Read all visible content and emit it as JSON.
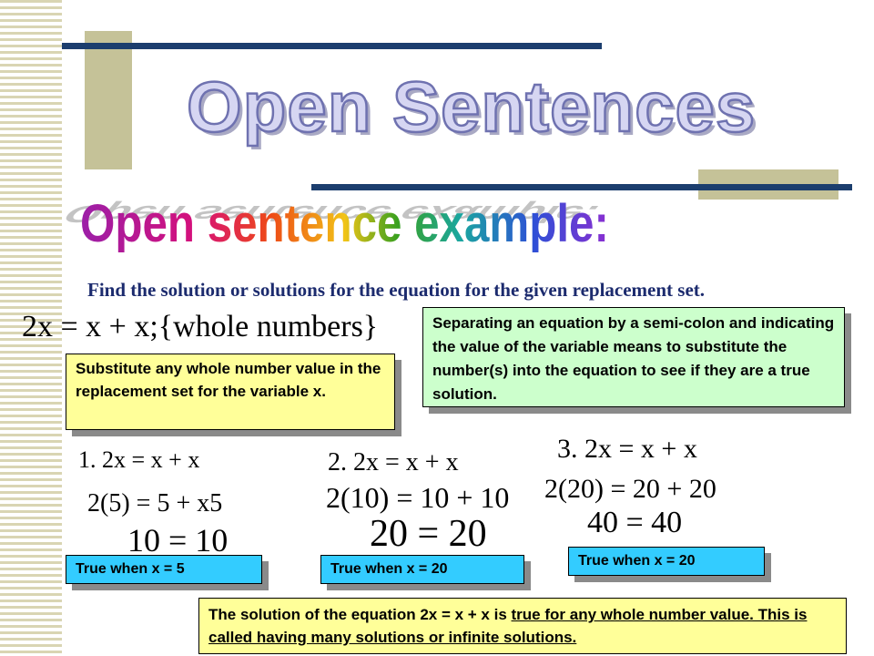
{
  "title": "Open Sentences",
  "subtitle": "Open sentence example:",
  "instruction": "Find the solution or solutions for the equation for the given replacement set.",
  "main_equation": "2x = x + x;{whole numbers}",
  "box_substitute": "Substitute any whole number value in the replacement set for the variable x.",
  "box_separating": "Separating an equation by a semi-colon and indicating the value of the variable means to substitute the number(s) into the equation to see if they are a true solution.",
  "examples": [
    {
      "eq": "1.  2x = x + x",
      "sub": "2(5) = 5 + x5",
      "result": "10 = 10",
      "label": "True when x = 5"
    },
    {
      "eq": "2. 2x = x + x",
      "sub": "2(10) = 10 + 10",
      "result": "20 = 20",
      "label": "True when x = 20"
    },
    {
      "eq": "3. 2x = x + x",
      "sub": "2(20) = 20 + 20",
      "result": "40 = 40",
      "label": "True when x = 20"
    }
  ],
  "conclusion": {
    "text": "The solution of the equation 2x = x + x is ",
    "underlined": "true for any whole number value. This is called having many solutions or infinite solutions."
  },
  "colors": {
    "navy": "#1c3e6e",
    "tan": "#c5c298",
    "yellow": "#ffff99",
    "green": "#ccffcc",
    "cyan": "#33ccff"
  }
}
